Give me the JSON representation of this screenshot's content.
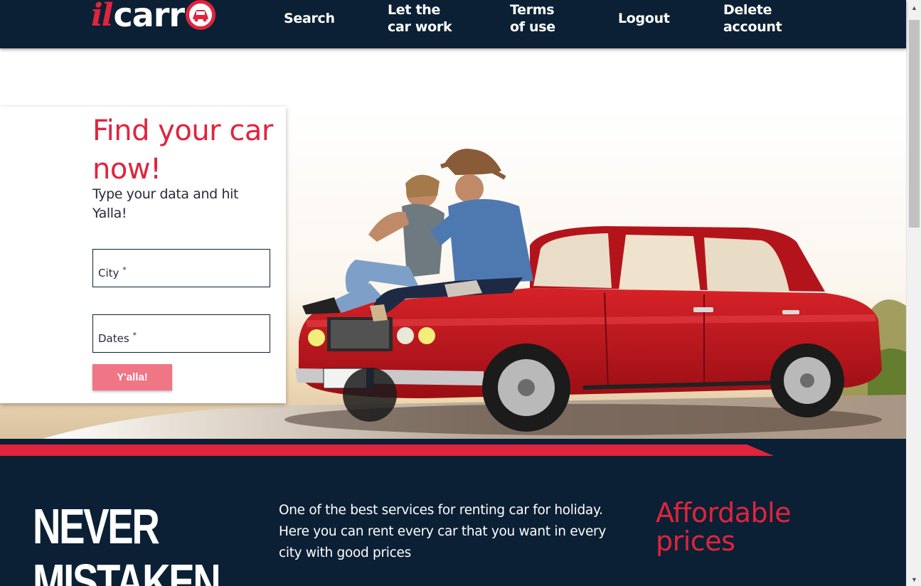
{
  "header": {
    "logo": {
      "il": "il",
      "carr": "carr"
    },
    "nav": {
      "search": "Search",
      "let_car_work_line1": "Let the",
      "let_car_work_line2": "car work",
      "terms_line1": "Terms",
      "terms_line2": "of use",
      "logout": "Logout",
      "delete_line1": "Delete",
      "delete_line2": "account"
    }
  },
  "search_form": {
    "title_line1": "Find your car",
    "title_line2": "now!",
    "subtitle": "Type your data and hit Yalla!",
    "city_label": "City",
    "dates_label": "Dates",
    "required_mark": "*",
    "submit_label": "Y'alla!"
  },
  "info": {
    "slogan_line1": "NEVER",
    "slogan_line2": "MISTAKEN",
    "description": "One of the best services for renting car for holiday. Here you can rent every car that you want in every city with good prices",
    "feature_title_line1": "Affordable",
    "feature_title_line2": "prices"
  },
  "colors": {
    "navy": "#0b2034",
    "brand_red": "#e0243d",
    "button_pink": "#f07585",
    "car_red": "#c0141c"
  },
  "icons": {
    "logo_car": "car-icon",
    "scroll_up": "triangle-up",
    "scroll_down": "triangle-down"
  }
}
